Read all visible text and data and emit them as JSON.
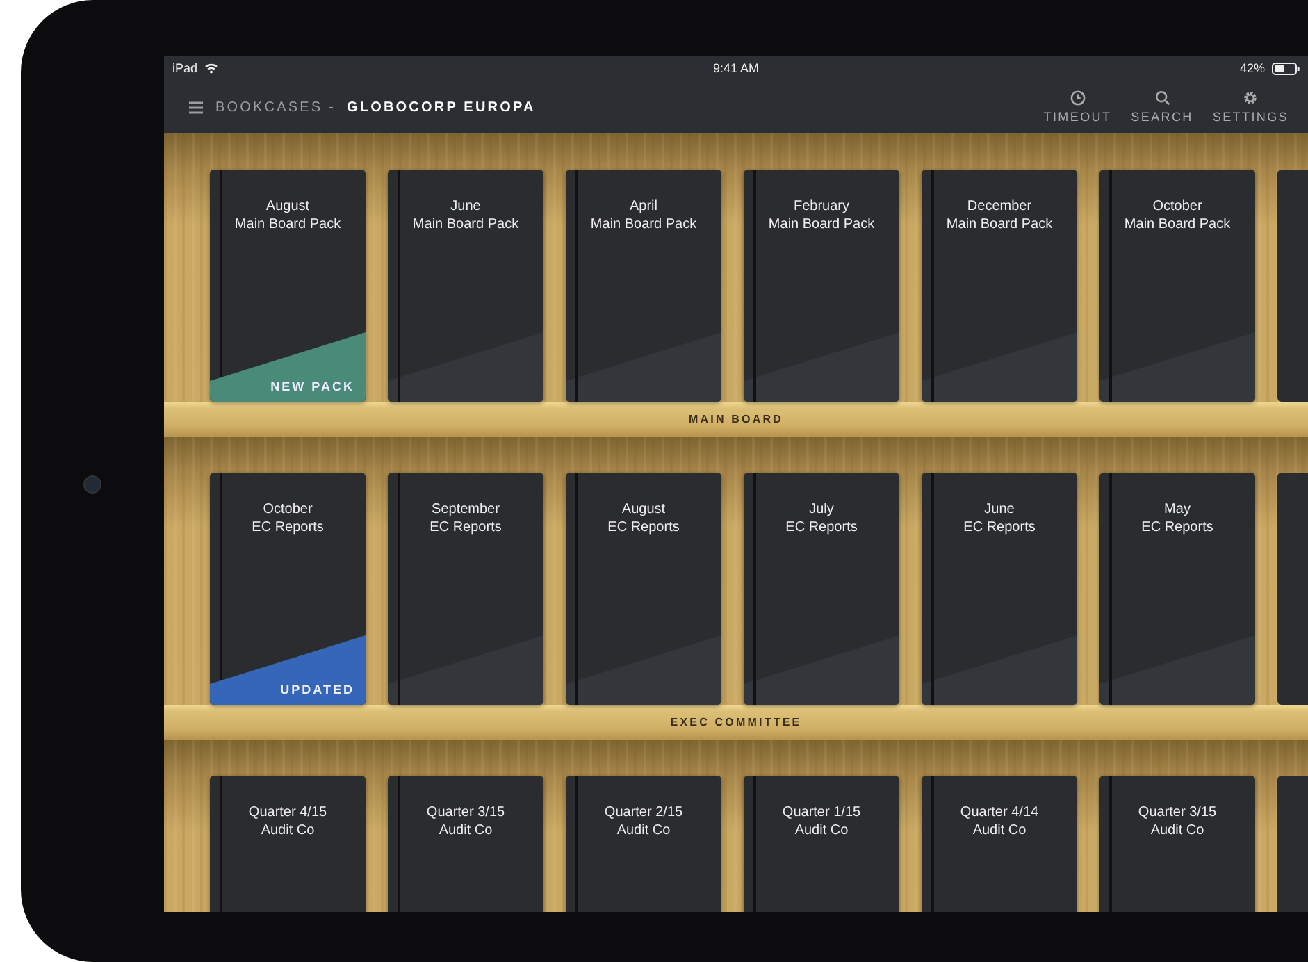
{
  "status_bar": {
    "device": "iPad",
    "time": "9:41 AM",
    "battery": "42%"
  },
  "nav": {
    "section": "BOOKCASES -",
    "title": "GLOBOCORP EUROPA",
    "actions": [
      {
        "kind": "timeout",
        "label": "TIMEOUT"
      },
      {
        "kind": "search",
        "label": "SEARCH"
      },
      {
        "kind": "settings",
        "label": "SETTINGS"
      }
    ]
  },
  "shelves": [
    {
      "label": "MAIN BOARD",
      "books": [
        {
          "title": "August",
          "subtitle": "Main Board Pack",
          "badge": {
            "label": "NEW PACK",
            "color": "#4a8a78"
          }
        },
        {
          "title": "June",
          "subtitle": "Main Board Pack"
        },
        {
          "title": "April",
          "subtitle": "Main Board Pack"
        },
        {
          "title": "February",
          "subtitle": "Main Board Pack"
        },
        {
          "title": "December",
          "subtitle": "Main Board Pack"
        },
        {
          "title": "October",
          "subtitle": "Main Board Pack"
        }
      ]
    },
    {
      "label": "EXEC COMMITTEE",
      "books": [
        {
          "title": "October",
          "subtitle": "EC Reports",
          "badge": {
            "label": "UPDATED",
            "color": "#3566b8"
          }
        },
        {
          "title": "September",
          "subtitle": "EC Reports"
        },
        {
          "title": "August",
          "subtitle": "EC Reports"
        },
        {
          "title": "July",
          "subtitle": "EC Reports"
        },
        {
          "title": "June",
          "subtitle": "EC Reports"
        },
        {
          "title": "May",
          "subtitle": "EC Reports"
        }
      ]
    },
    {
      "books": [
        {
          "title": "Quarter 4/15",
          "subtitle": "Audit Co"
        },
        {
          "title": "Quarter 3/15",
          "subtitle": "Audit Co"
        },
        {
          "title": "Quarter 2/15",
          "subtitle": "Audit Co"
        },
        {
          "title": "Quarter 1/15",
          "subtitle": "Audit Co"
        },
        {
          "title": "Quarter 4/14",
          "subtitle": "Audit Co"
        },
        {
          "title": "Quarter 3/15",
          "subtitle": "Audit Co"
        }
      ]
    }
  ]
}
